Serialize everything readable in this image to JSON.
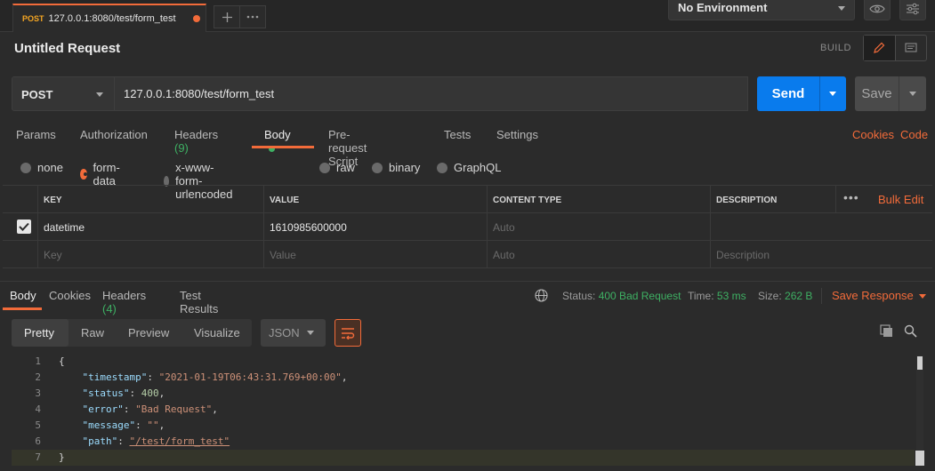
{
  "tab": {
    "method": "POST",
    "title": "127.0.0.1:8080/test/form_test"
  },
  "environment": {
    "selected": "No Environment"
  },
  "request": {
    "title": "Untitled Request",
    "build_label": "BUILD",
    "method": "POST",
    "url": "127.0.0.1:8080/test/form_test",
    "send_label": "Send",
    "save_label": "Save"
  },
  "request_tabs": {
    "params": "Params",
    "authorization": "Authorization",
    "headers": "Headers",
    "headers_count": "(9)",
    "body": "Body",
    "prerequest": "Pre-request Script",
    "tests": "Tests",
    "settings": "Settings",
    "cookies": "Cookies",
    "code": "Code"
  },
  "body_types": {
    "none": "none",
    "form_data": "form-data",
    "urlencoded": "x-www-form-urlencoded",
    "raw": "raw",
    "binary": "binary",
    "graphql": "GraphQL"
  },
  "form_table": {
    "headers": {
      "key": "KEY",
      "value": "VALUE",
      "content_type": "CONTENT TYPE",
      "description": "DESCRIPTION"
    },
    "bulk_edit": "Bulk Edit",
    "row": {
      "key": "datetime",
      "value": "1610985600000",
      "content_type": "Auto"
    },
    "placeholder": {
      "key": "Key",
      "value": "Value",
      "content_type": "Auto",
      "description": "Description"
    }
  },
  "response_tabs": {
    "body": "Body",
    "cookies": "Cookies",
    "headers": "Headers",
    "headers_count": "(4)",
    "test_results": "Test Results"
  },
  "response_status": {
    "status_label": "Status:",
    "status_value": "400 Bad Request",
    "time_label": "Time:",
    "time_value": "53 ms",
    "size_label": "Size:",
    "size_value": "262 B",
    "save_response": "Save Response"
  },
  "viewer": {
    "pretty": "Pretty",
    "raw": "Raw",
    "preview": "Preview",
    "visualize": "Visualize",
    "language": "JSON"
  },
  "response_body": {
    "line1": "{",
    "timestamp_key": "\"timestamp\"",
    "timestamp_value": "\"2021-01-19T06:43:31.769+00:00\"",
    "status_key": "\"status\"",
    "status_value": "400",
    "error_key": "\"error\"",
    "error_value": "\"Bad Request\"",
    "message_key": "\"message\"",
    "message_value": "\"\"",
    "path_key": "\"path\"",
    "path_value": "\"/test/form_test\"",
    "line7": "}"
  },
  "colors": {
    "accent": "#f26b3a",
    "send": "#097bed",
    "success": "#3eb063"
  }
}
